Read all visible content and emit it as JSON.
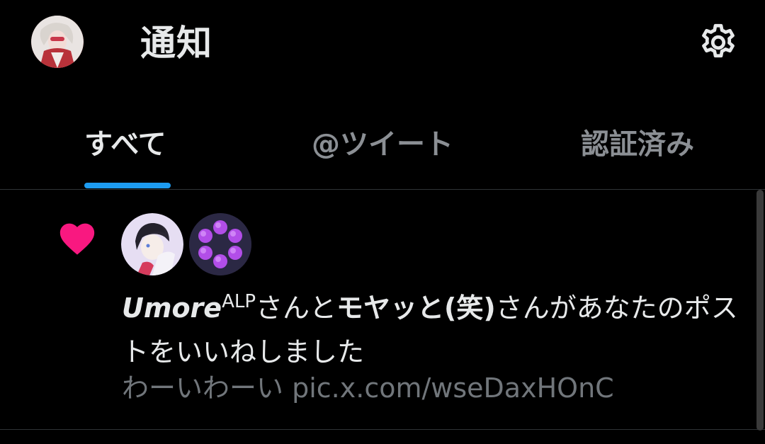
{
  "header": {
    "title": "通知",
    "avatar_icon": "user-avatar",
    "settings_icon": "gear-icon"
  },
  "tabs": [
    {
      "label": "すべて",
      "active": true
    },
    {
      "label": "@ツイート",
      "active": false
    },
    {
      "label": "認証済み",
      "active": false
    }
  ],
  "notification": {
    "type_icon": "heart-icon",
    "user1_name": "Umore",
    "user1_suffix": "ALP",
    "text_part1": "さんと",
    "user2_name": "モヤッと(笑)",
    "text_part2": "さんがあなたのポストをいいねしました",
    "post_text": "わーいわーい",
    "post_link": "pic.x.com/wseDaxHOnC"
  },
  "colors": {
    "accent": "#1d9bf0",
    "like": "#f91880",
    "background": "#000000",
    "secondary_text": "#71767b"
  }
}
